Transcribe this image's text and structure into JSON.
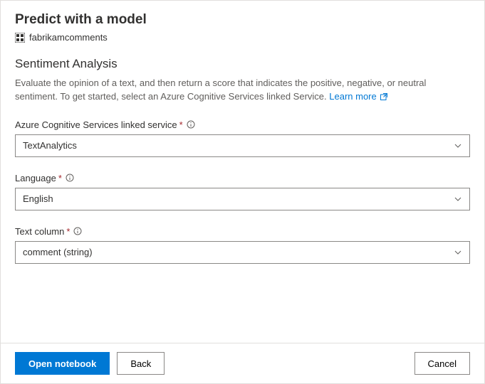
{
  "header": {
    "title": "Predict with a model",
    "resource_name": "fabrikamcomments"
  },
  "section": {
    "title": "Sentiment Analysis",
    "description": "Evaluate the opinion of a text, and then return a score that indicates the positive, negative, or neutral sentiment. To get started, select an Azure Cognitive Services linked Service. ",
    "learn_more": "Learn more"
  },
  "fields": {
    "linked_service": {
      "label": "Azure Cognitive Services linked service",
      "value": "TextAnalytics"
    },
    "language": {
      "label": "Language",
      "value": "English"
    },
    "text_column": {
      "label": "Text column",
      "value": "comment (string)"
    }
  },
  "footer": {
    "open_notebook": "Open notebook",
    "back": "Back",
    "cancel": "Cancel"
  }
}
